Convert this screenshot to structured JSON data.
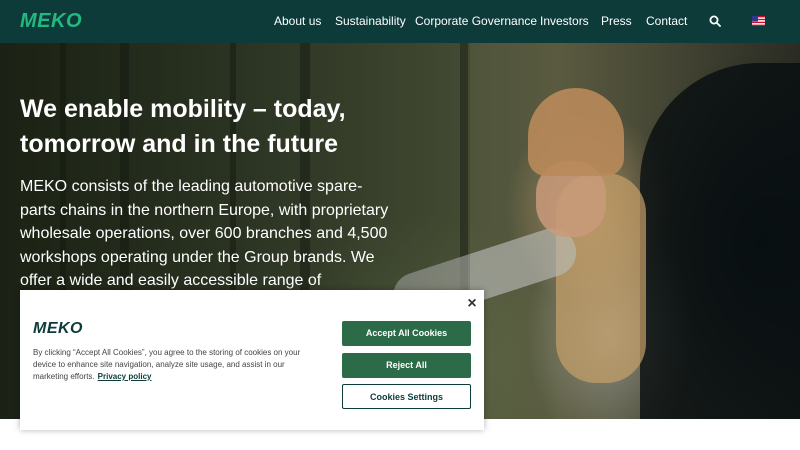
{
  "header": {
    "logo": "MEKO",
    "nav": [
      "About us",
      "Sustainability",
      "Corporate Governance",
      "Investors",
      "Press",
      "Contact"
    ],
    "search_icon": "search-icon",
    "language_icon": "us-flag-icon"
  },
  "hero": {
    "title": "We enable mobility – today, tomorrow and in the future",
    "text": "MEKO consists of the leading automotive spare-parts chains in the northern Europe, with proprietary wholesale operations, over 600 branches and 4,500 workshops operating under the Group brands. We offer a wide and easily accessible range of"
  },
  "cookie_banner": {
    "logo": "MEKO",
    "text": "By clicking “Accept All Cookies”, you agree to the storing of cookies on your device to enhance site navigation, analyze site usage, and assist in our marketing efforts.",
    "privacy_link": "Privacy policy",
    "accept_label": "Accept All Cookies",
    "reject_label": "Reject All",
    "settings_label": "Cookies Settings",
    "close_label": "×"
  },
  "colors": {
    "header_bg": "#0c3b3a",
    "logo_green": "#22b97f",
    "button_green": "#2c6b47"
  }
}
